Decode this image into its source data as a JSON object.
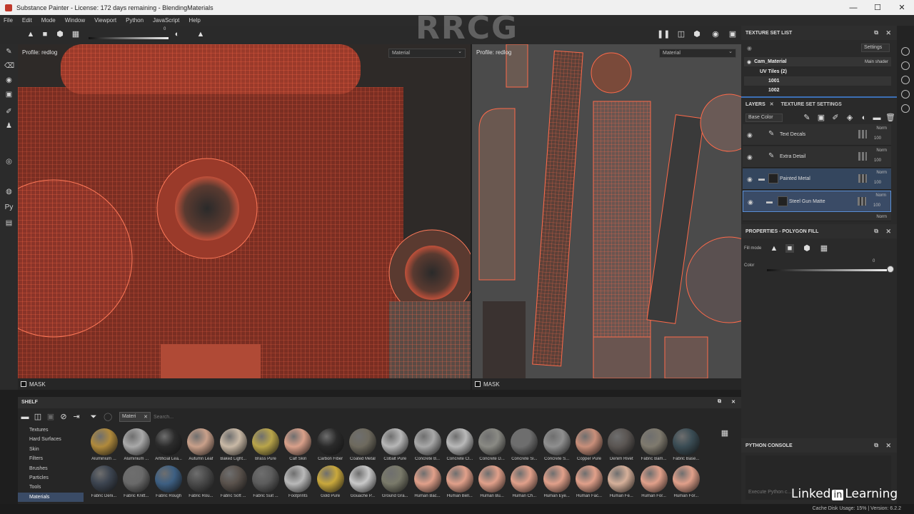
{
  "window": {
    "title": "Substance Painter - License: 172 days remaining - BlendingMaterials"
  },
  "menu": [
    "File",
    "Edit",
    "Mode",
    "Window",
    "Viewport",
    "Python",
    "JavaScript",
    "Help"
  ],
  "toolbar": {
    "slider_value": "0"
  },
  "watermark": "RRCG",
  "viewport_3d": {
    "profile": "Profile: redlog",
    "channel": "Material",
    "mask_label": "MASK"
  },
  "viewport_2d": {
    "profile": "Profile: redlog",
    "channel": "Material",
    "mask_label": "MASK"
  },
  "texture_set_list": {
    "title": "TEXTURE SET LIST",
    "settings": "Settings",
    "set_name": "Cam_Material",
    "shader": "Main shader",
    "uv_group": "UV Tiles (2)",
    "tiles": [
      "1001",
      "1002"
    ]
  },
  "layers": {
    "tab": "LAYERS",
    "tab2": "TEXTURE SET SETTINGS",
    "channel": "Base Color",
    "items": [
      {
        "name": "Text Decals",
        "blend": "Norm",
        "opacity": "100"
      },
      {
        "name": "Extra Detail",
        "blend": "Norm",
        "opacity": "100"
      },
      {
        "name": "Painted Metal",
        "blend": "Norm",
        "opacity": "100"
      },
      {
        "name": "Steel Gun Matte",
        "blend": "Norm",
        "opacity": "100"
      },
      {
        "name": "",
        "blend": "Norm",
        "opacity": ""
      }
    ]
  },
  "properties": {
    "title": "PROPERTIES - POLYGON FILL",
    "fill_mode_label": "Fill mode",
    "color_label": "Color",
    "color_value": "0"
  },
  "python_console": {
    "title": "PYTHON CONSOLE",
    "placeholder": "Execute Python c..."
  },
  "shelf": {
    "title": "SHELF",
    "filter_tag": "Materi",
    "search_placeholder": "Search...",
    "categories": [
      "Textures",
      "Hard Surfaces",
      "Skin",
      "Filters",
      "Brushes",
      "Particles",
      "Tools",
      "Materials"
    ],
    "selected_category": "Materials",
    "materials": [
      {
        "name": "Aluminium ...",
        "color": "#b08a3c"
      },
      {
        "name": "Aluminium ...",
        "color": "#a9a9a9"
      },
      {
        "name": "Artificial Lea...",
        "color": "#2b2b2b"
      },
      {
        "name": "Autumn Leaf",
        "color": "#c9a08a"
      },
      {
        "name": "Baked Light...",
        "color": "#c9b9a6"
      },
      {
        "name": "Brass Pure",
        "color": "#b9a54a"
      },
      {
        "name": "Calf Skin",
        "color": "#d9a08a"
      },
      {
        "name": "Carbon Fiber",
        "color": "#2a2a2a"
      },
      {
        "name": "Coated Metal",
        "color": "#6e6a5e"
      },
      {
        "name": "Cobalt Pure",
        "color": "#b7b7b7"
      },
      {
        "name": "Concrete B...",
        "color": "#a8a8a8"
      },
      {
        "name": "Concrete Cl...",
        "color": "#b9b9b9"
      },
      {
        "name": "Concrete D...",
        "color": "#8a8a84"
      },
      {
        "name": "Concrete Si...",
        "color": "#6e6e6e"
      },
      {
        "name": "Concrete S...",
        "color": "#8f8f8f"
      },
      {
        "name": "Copper Pure",
        "color": "#c98f7a"
      },
      {
        "name": "Denim Rivet",
        "color": "#5a5552"
      },
      {
        "name": "Fabric Bam...",
        "color": "#7f7a6e"
      },
      {
        "name": "Fabric Base...",
        "color": "#3a4c54"
      },
      {
        "name": "Fabric Deni...",
        "color": "#3c4450"
      },
      {
        "name": "Fabric Knitt...",
        "color": "#6a6a6a"
      },
      {
        "name": "Fabric Rough",
        "color": "#3d5f82"
      },
      {
        "name": "Fabric Rou...",
        "color": "#4a4a4a"
      },
      {
        "name": "Fabric Soft ...",
        "color": "#5a524c"
      },
      {
        "name": "Fabric Suit ...",
        "color": "#5c5c5c"
      },
      {
        "name": "Footprints",
        "color": "#b9b9b9"
      },
      {
        "name": "Gold Pure",
        "color": "#c9a83c"
      },
      {
        "name": "Gouache P...",
        "color": "#c9c9c9"
      },
      {
        "name": "Ground Gra...",
        "color": "#7a7a6a"
      },
      {
        "name": "Human Bac...",
        "color": "#e1a08a"
      },
      {
        "name": "Human Bell...",
        "color": "#e1a08a"
      },
      {
        "name": "Human Bu...",
        "color": "#e1a08a"
      },
      {
        "name": "Human Ch...",
        "color": "#e1a08a"
      },
      {
        "name": "Human Eye...",
        "color": "#e1a08a"
      },
      {
        "name": "Human Fac...",
        "color": "#e1a08a"
      },
      {
        "name": "Human Fe...",
        "color": "#d6b09a"
      },
      {
        "name": "Human For...",
        "color": "#e1a08a"
      },
      {
        "name": "Human For...",
        "color": "#e1a08a"
      }
    ]
  },
  "status": {
    "cache": "Cache Disk Usage:    15% | Version: 6.2.2"
  },
  "branding": {
    "linkedin_left": "Linked",
    "linkedin_in": "in",
    "linkedin_right": "Learning"
  }
}
